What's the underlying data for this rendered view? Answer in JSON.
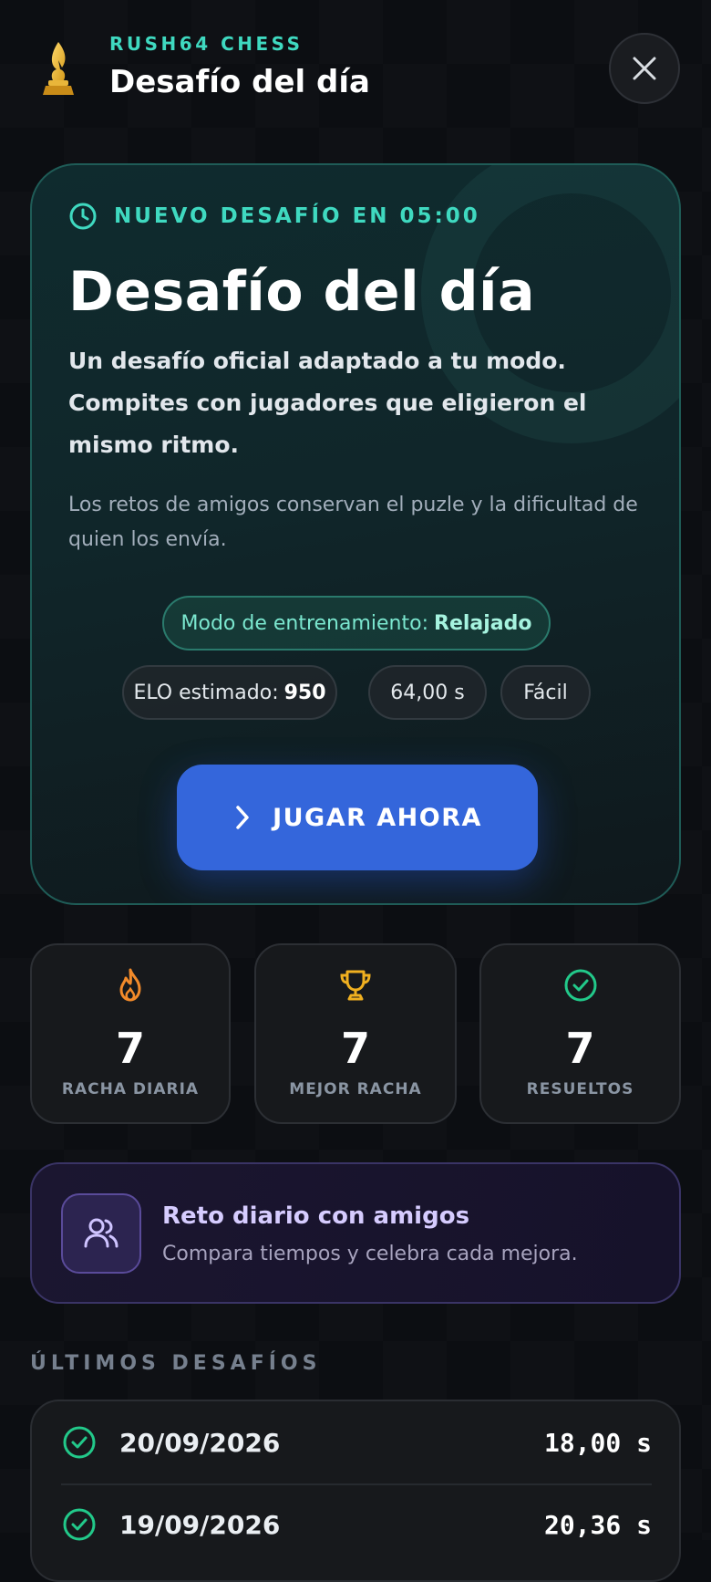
{
  "header": {
    "brand": "RUSH64 CHESS",
    "title": "Desafío del día",
    "close_icon": "close-icon"
  },
  "hero": {
    "timer_label": "NUEVO DESAFÍO EN 05:00",
    "title": "Desafío del día",
    "subtitle": "Un desafío oficial adaptado a tu modo. Compites con jugadores que eligieron el mismo ritmo.",
    "note": "Los retos de amigos conservan el puzle y la dificultad de quien los envía.",
    "mode_label": "Modo de entrenamiento:",
    "mode_value": "Relajado",
    "elo_label": "ELO estimado:",
    "elo_value": "950",
    "time_chip": "64,00 s",
    "difficulty_chip": "Fácil",
    "play_button": "JUGAR AHORA"
  },
  "stats": [
    {
      "icon": "flame-icon",
      "value": "7",
      "label": "RACHA DIARIA"
    },
    {
      "icon": "trophy-icon",
      "value": "7",
      "label": "MEJOR RACHA"
    },
    {
      "icon": "check-circle-icon",
      "value": "7",
      "label": "RESUELTOS"
    }
  ],
  "friends_card": {
    "title": "Reto diario con amigos",
    "subtitle": "Compara tiempos y celebra cada mejora."
  },
  "history": {
    "section_title": "ÚLTIMOS DESAFÍOS",
    "rows": [
      {
        "date": "20/09/2026",
        "time": "18,00 s"
      },
      {
        "date": "19/09/2026",
        "time": "20,36 s"
      }
    ]
  },
  "colors": {
    "accent_teal": "#3fd9c0",
    "play_blue": "#3466db",
    "flame_orange": "#f28a2a",
    "trophy_gold": "#f0b020",
    "check_green": "#22c98a",
    "friends_purple": "#d6ccff"
  }
}
